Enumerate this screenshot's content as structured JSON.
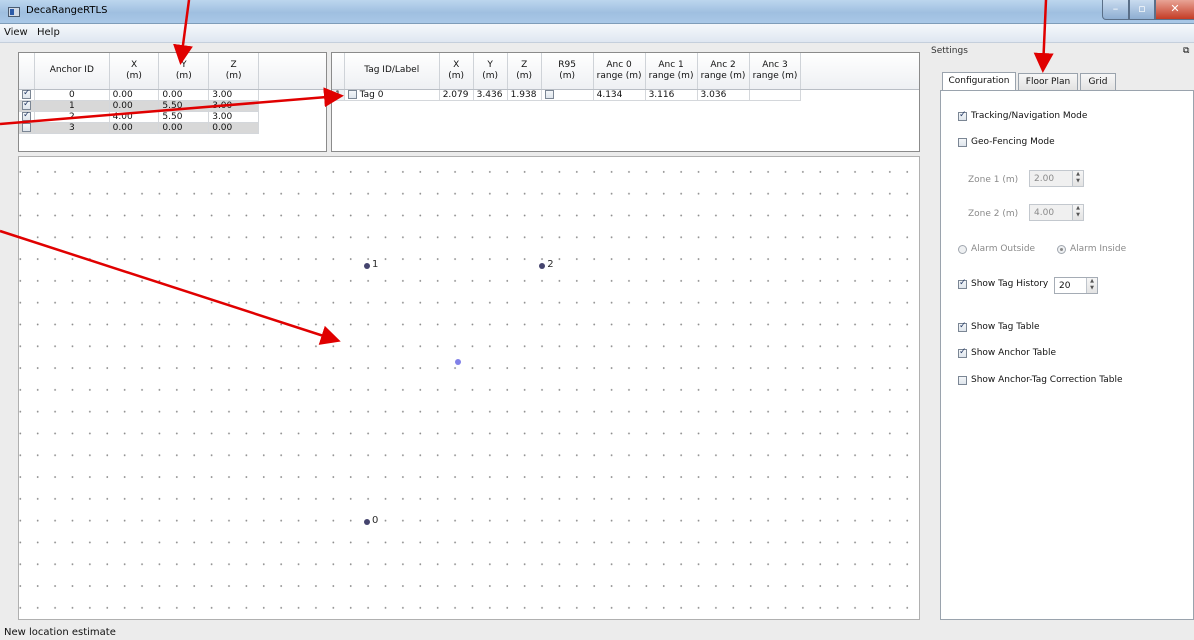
{
  "window": {
    "title": "DecaRangeRTLS"
  },
  "menu": [
    "View",
    "Help"
  ],
  "anchor_table": {
    "headers": [
      {
        "l1": "Anchor ID",
        "l2": ""
      },
      {
        "l1": "X",
        "l2": "(m)"
      },
      {
        "l1": "Y",
        "l2": "(m)"
      },
      {
        "l1": "Z",
        "l2": "(m)"
      }
    ],
    "rows": [
      {
        "checked": true,
        "id": "0",
        "x": "0.00",
        "y": "0.00",
        "z": "3.00"
      },
      {
        "checked": true,
        "id": "1",
        "x": "0.00",
        "y": "5.50",
        "z": "3.00"
      },
      {
        "checked": true,
        "id": "2",
        "x": "4.00",
        "y": "5.50",
        "z": "3.00"
      },
      {
        "checked": false,
        "id": "3",
        "x": "0.00",
        "y": "0.00",
        "z": "0.00"
      }
    ]
  },
  "tag_table": {
    "headers": [
      {
        "l1": "Tag ID/Label",
        "l2": ""
      },
      {
        "l1": "X",
        "l2": "(m)"
      },
      {
        "l1": "Y",
        "l2": "(m)"
      },
      {
        "l1": "Z",
        "l2": "(m)"
      },
      {
        "l1": "R95",
        "l2": "(m)"
      },
      {
        "l1": "Anc 0",
        "l2": "range (m)"
      },
      {
        "l1": "Anc 1",
        "l2": "range (m)"
      },
      {
        "l1": "Anc 2",
        "l2": "range (m)"
      },
      {
        "l1": "Anc 3",
        "l2": "range (m)"
      }
    ],
    "rows": [
      {
        "row_num": "1",
        "label": "Tag 0",
        "x": "2.079",
        "y": "3.436",
        "z": "1.938",
        "r95_checked": false,
        "anc0": "4.134",
        "anc1": "3.116",
        "anc2": "3.036",
        "anc3": ""
      }
    ]
  },
  "plot": {
    "anchors": [
      {
        "label": "1",
        "x": 0.0,
        "y": 5.5
      },
      {
        "label": "2",
        "x": 4.0,
        "y": 5.5
      },
      {
        "label": "0",
        "x": 0.0,
        "y": 0.0
      }
    ],
    "tag": {
      "x": 2.079,
      "y": 3.436
    }
  },
  "settings": {
    "dock_title": "Settings",
    "tabs": [
      "Configuration",
      "Floor Plan",
      "Grid"
    ],
    "active_tab": "Configuration",
    "tracking_mode": {
      "label": "Tracking/Navigation Mode",
      "checked": true
    },
    "geofencing_mode": {
      "label": "Geo-Fencing Mode",
      "checked": false
    },
    "zone1": {
      "label": "Zone 1 (m)",
      "value": "2.00"
    },
    "zone2": {
      "label": "Zone 2 (m)",
      "value": "4.00"
    },
    "alarm_outside": {
      "label": "Alarm Outside",
      "selected": false
    },
    "alarm_inside": {
      "label": "Alarm Inside",
      "selected": true
    },
    "show_tag_history": {
      "label": "Show Tag History",
      "checked": true,
      "value": "20"
    },
    "show_tag_table": {
      "label": "Show Tag Table",
      "checked": true
    },
    "show_anchor_table": {
      "label": "Show Anchor Table",
      "checked": true
    },
    "show_correction_table": {
      "label": "Show Anchor-Tag Correction Table",
      "checked": false
    }
  },
  "status": "New location estimate",
  "colors": {
    "annotation_arrow": "#e00000",
    "anchor_dot": "#45446e",
    "tag_dot": "#8181e8"
  }
}
